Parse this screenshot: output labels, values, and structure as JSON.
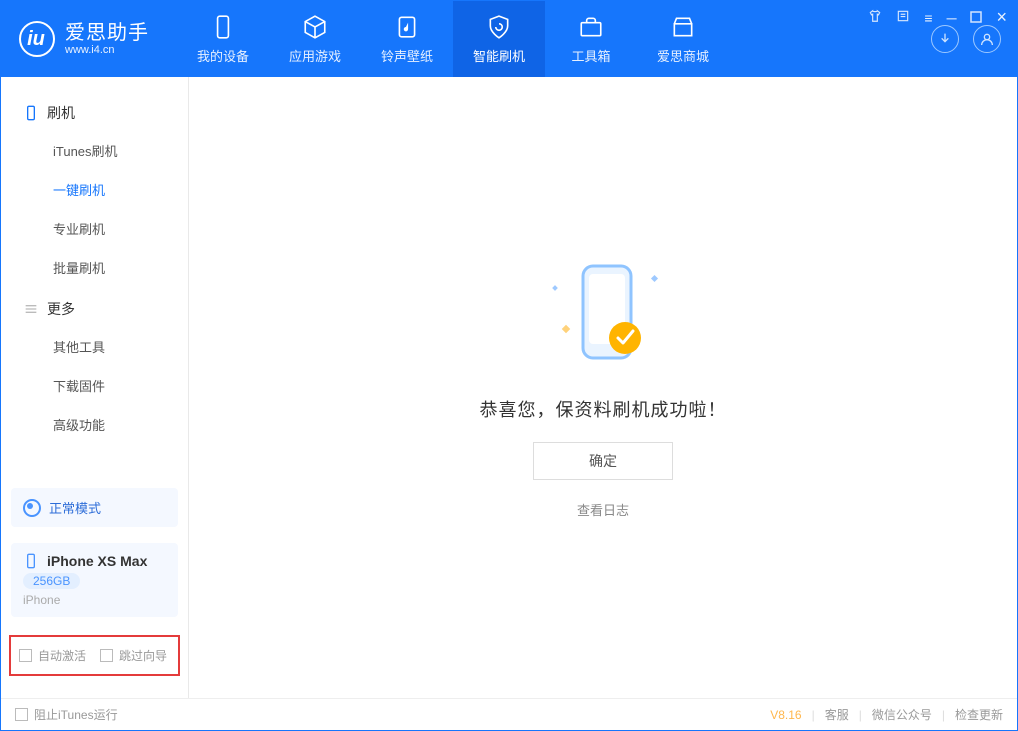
{
  "app": {
    "name": "爱思助手",
    "domain": "www.i4.cn"
  },
  "tabs": [
    {
      "label": "我的设备"
    },
    {
      "label": "应用游戏"
    },
    {
      "label": "铃声壁纸"
    },
    {
      "label": "智能刷机"
    },
    {
      "label": "工具箱"
    },
    {
      "label": "爱思商城"
    }
  ],
  "sidebar": {
    "group1_title": "刷机",
    "group1_items": [
      {
        "label": "iTunes刷机"
      },
      {
        "label": "一键刷机"
      },
      {
        "label": "专业刷机"
      },
      {
        "label": "批量刷机"
      }
    ],
    "group2_title": "更多",
    "group2_items": [
      {
        "label": "其他工具"
      },
      {
        "label": "下载固件"
      },
      {
        "label": "高级功能"
      }
    ]
  },
  "mode": {
    "label": "正常模式"
  },
  "device": {
    "name": "iPhone XS Max",
    "capacity": "256GB",
    "type": "iPhone"
  },
  "options": {
    "auto_activate": "自动激活",
    "skip_guide": "跳过向导"
  },
  "main": {
    "success_msg": "恭喜您，保资料刷机成功啦！",
    "ok_button": "确定",
    "view_log": "查看日志"
  },
  "status": {
    "block_itunes": "阻止iTunes运行",
    "version": "V8.16",
    "support": "客服",
    "wechat": "微信公众号",
    "check_update": "检查更新"
  }
}
